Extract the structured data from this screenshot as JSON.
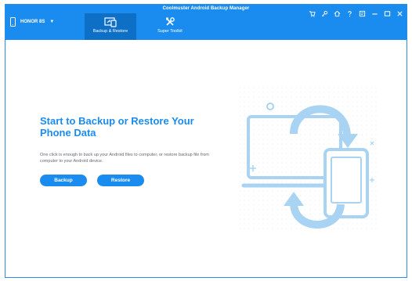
{
  "window": {
    "title": "Coolmuster Android Backup Manager"
  },
  "device": {
    "name": "HONOR 8S"
  },
  "tabs": [
    {
      "label": "Backup & Restore",
      "icon": "backup-restore-icon",
      "active": true
    },
    {
      "label": "Super Toolkit",
      "icon": "toolkit-icon",
      "active": false
    }
  ],
  "window_controls": [
    "cart-icon",
    "key-icon",
    "home-icon",
    "help-icon",
    "feedback-icon",
    "minimize-icon",
    "maximize-icon",
    "close-icon"
  ],
  "main": {
    "headline": "Start to Backup or Restore Your Phone Data",
    "description": "One click is enough to back up your Android files to computer, or restore backup file from computer to your Android device.",
    "backup_label": "Backup",
    "restore_label": "Restore"
  },
  "colors": {
    "accent": "#1a8cf0",
    "active_tab": "#0e6fc6",
    "illustration": "#a9d3f2"
  }
}
